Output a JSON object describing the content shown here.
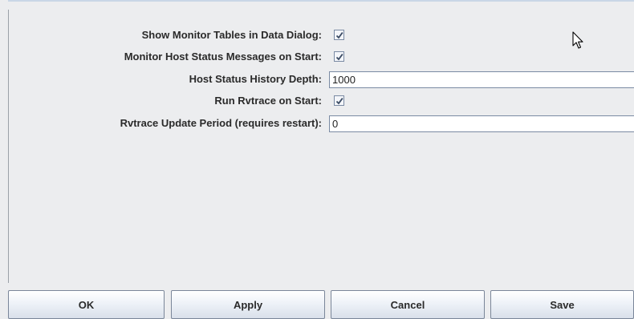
{
  "settings": {
    "show_monitor_tables": {
      "label": "Show Monitor Tables in Data Dialog:",
      "checked": true
    },
    "monitor_host_status": {
      "label": "Monitor Host Status Messages on Start:",
      "checked": true
    },
    "host_status_history_depth": {
      "label": "Host Status History Depth:",
      "value": "1000"
    },
    "run_rvtrace": {
      "label": "Run Rvtrace on Start:",
      "checked": true
    },
    "rvtrace_update_period": {
      "label": "Rvtrace Update Period (requires restart):",
      "value": "0"
    }
  },
  "buttons": {
    "ok": "OK",
    "apply": "Apply",
    "cancel": "Cancel",
    "save": "Save"
  }
}
